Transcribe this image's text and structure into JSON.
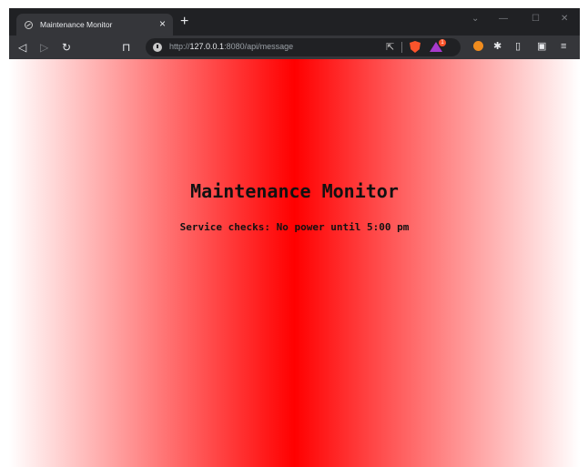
{
  "browser": {
    "tab": {
      "title": "Maintenance Monitor",
      "close": "×"
    },
    "new_tab": "+",
    "window_controls": {
      "minimize": "—",
      "maximize": "☐",
      "close": "✕",
      "tab_search": "⌄"
    },
    "toolbar": {
      "back": "◁",
      "forward": "▷",
      "reload": "↻",
      "bookmark": "⊓"
    },
    "address_bar": {
      "scheme": "http://",
      "host": "127.0.0.1",
      "rest": ":8080/api/message"
    },
    "rewards_badge": "1",
    "icons": [
      "globe-icon",
      "info-icon",
      "share-icon",
      "brave-shields-icon",
      "brave-rewards-icon",
      "extension-icon",
      "puzzle-icon",
      "sidebar-icon",
      "wallet-icon",
      "menu-icon"
    ]
  },
  "page": {
    "title": "Maintenance Monitor",
    "message": "Service checks: No power until 5:00 pm",
    "background": {
      "center": "#ff0000",
      "edges": "#ffffff"
    }
  }
}
